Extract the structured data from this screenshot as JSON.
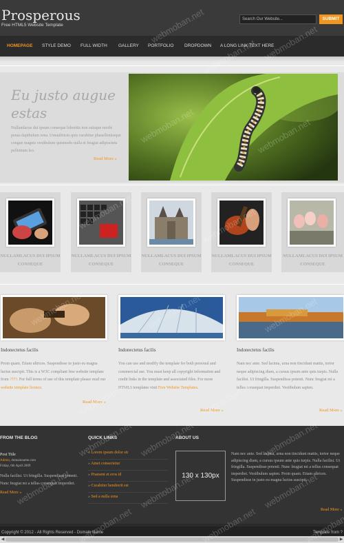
{
  "header": {
    "logo": "Prosperous",
    "tagline": "Free HTML5 Website Template",
    "search_placeholder": "Search Our Website...",
    "search_button": "SUBMIT"
  },
  "nav": {
    "items": [
      "HOMEPAGE",
      "STYLE DEMO",
      "FULL WIDTH",
      "GALLERY",
      "PORTFOLIO",
      "DROPDOWN",
      "A LONG LINK TEXT HERE"
    ]
  },
  "hero": {
    "title": "Eu justo augue estas",
    "text": "Nullamlacus dui ipsum conseque loborttis non euisque morbi penas dapibulum orna. Urnaultrices quis curabitur phasellentesque congue magnis vestibulum quismodo nulla et feugiat adipiscinia pellentum leo.",
    "more": "Read More »"
  },
  "gallery": {
    "caption": "NULLAMLACUS DUI IPSUM CONSEQUE"
  },
  "features": [
    {
      "title": "Indonectetus facilis",
      "text": "Proin quam. Etiam ultrices. Suspendisse in justo eu magna luctus suscipit. This is a W3C compliant free website template from",
      "link1": "????",
      "text2": ". For full terms of use of this template please read our",
      "link2": "website template licence",
      "text3": ".",
      "more": "Read More »"
    },
    {
      "title": "Indonectetus facilis",
      "text": "You can use and modify the template for both personal and commercial use. You must keep all copyright information and credit links in the template and associated files. For more HTML5 templates visit",
      "link1": "Free Website Templates",
      "text2": ".",
      "more": "Read More »"
    },
    {
      "title": "Indonectetus facilis",
      "text": "Nam nec ante. Sed lacinia, urna non tincidunt mattis, tortor neque adipiscing diam, a cursus ipsum ante quis turpis. Nulla facilisi. Ut fringilla. Suspendisse potenti. Nunc feugiat mi a tellus consequat imperdiet. Vestibulum sapien.",
      "more": "Read More »"
    }
  ],
  "footer": {
    "blog_heading": "FROM THE BLOG",
    "post_title": "Post Title",
    "post_author": "Admin",
    "post_domain": ", domainname.com",
    "post_date": "Friday, 6th April 2009",
    "post_text": "Nulla facilisi. Ut fringilla. Suspendisse potenti. Nunc feugiat mi a tellus consequat imperdiet.",
    "blog_more": "Read More »",
    "links_heading": "QUICK LINKS",
    "links": [
      "Lorem ipsum dolor sit",
      "Amet consectetur",
      "Praesent et eros id",
      "Curabitur hendrerit est",
      "Sed a nulla urna"
    ],
    "about_heading": "ABOUT US",
    "about_box": "130 x 130px",
    "about_text": "Nam nec ante. Sed lacinia, urna non tincidunt mattis, tortor neque adipiscing diam, a cursus ipsum ante quis turpis. Nulla facilisi. Ut fringilla. Suspendisse potenti. Nunc feugiat mi a tellus consequat imperdiet. Vestibulum sapien. Proin quam. Etiam ultrices. Suspendisse in justo eu magna luctus suscipit.",
    "about_more": "Read More »"
  },
  "bottom": {
    "copyright": "Copyright © 2012 - All Rights Reserved - Domain Name",
    "right": "Template from ?"
  },
  "watermark": "webmoban.net",
  "colors": {
    "accent": "#f29420",
    "dark": "#333333"
  }
}
